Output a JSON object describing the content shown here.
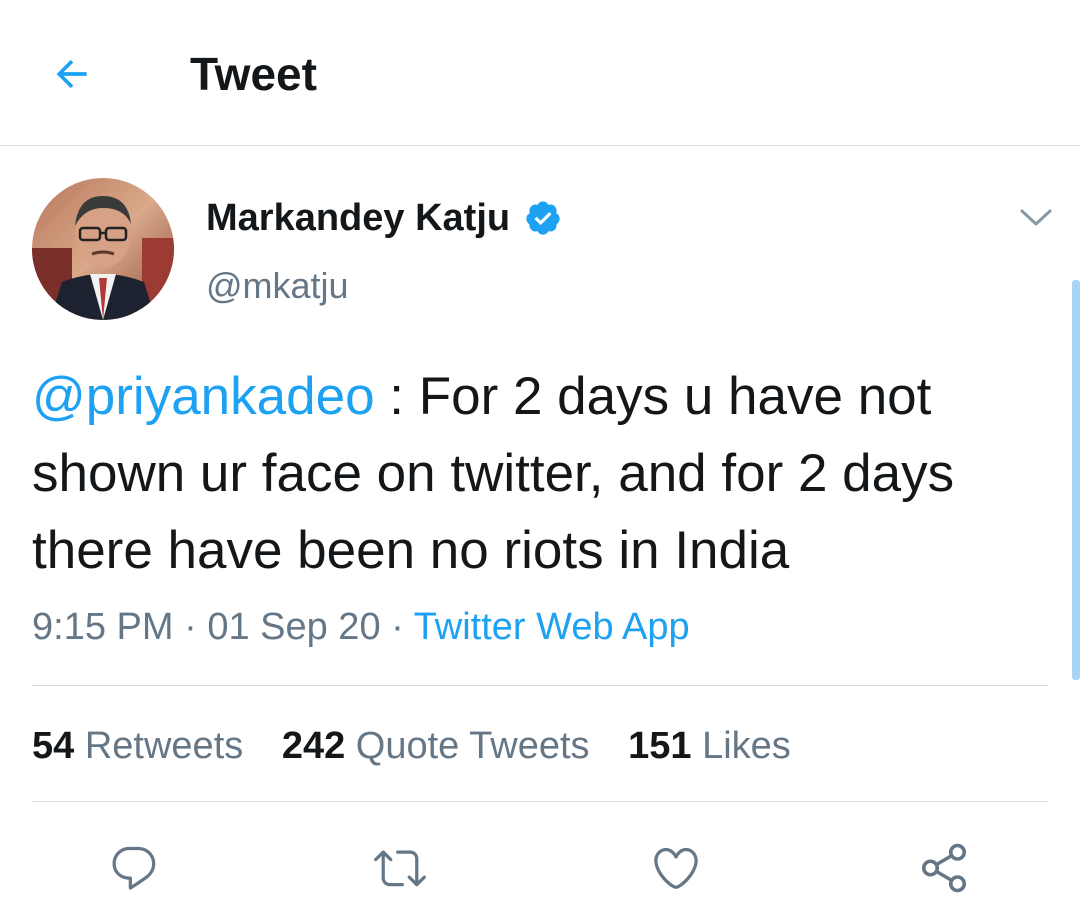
{
  "header": {
    "title": "Tweet"
  },
  "tweet": {
    "author_name": "Markandey Katju",
    "handle": "@mkatju",
    "mention": "@priyankadeo",
    "body": " : For 2 days u have not shown ur face on twitter, and for 2 days there have been no riots in India",
    "time": "9:15 PM",
    "date": "01 Sep 20",
    "separator": " · ",
    "source": "Twitter Web App"
  },
  "stats": {
    "retweets_count": "54",
    "retweets_label": "Retweets",
    "quotes_count": "242",
    "quotes_label": "Quote Tweets",
    "likes_count": "151",
    "likes_label": "Likes"
  },
  "icons": {
    "back": "arrow-left-icon",
    "verified": "verified-badge-icon",
    "caret": "chevron-down-icon",
    "reply": "reply-icon",
    "retweet": "retweet-icon",
    "like": "heart-icon",
    "share": "share-icon"
  },
  "colors": {
    "accent": "#1da1f2",
    "text": "#14171a",
    "secondary": "#657786",
    "divider": "#d6dadd"
  }
}
